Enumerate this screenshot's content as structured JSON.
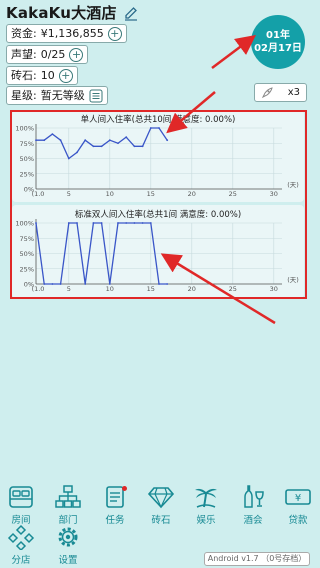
{
  "header": {
    "hotel_name": "KakaKu大酒店"
  },
  "stats": {
    "funds_label": "资金:",
    "funds_value": "¥1,136,855",
    "reputation_label": "声望:",
    "reputation_value": "0/25",
    "bricks_label": "砖石:",
    "bricks_value": "10",
    "star_label": "星级:",
    "star_value": "暂无等级"
  },
  "date": {
    "year": "01年",
    "day": "02月17日"
  },
  "speed": {
    "label": "x3"
  },
  "charts": {
    "single": {
      "title": "单人间入住率(总共10间 满意度: 0.00%)"
    },
    "double": {
      "title": "标准双人间入住率(总共1间 满意度: 0.00%)"
    }
  },
  "chart_data": [
    {
      "type": "line",
      "title": "单人间入住率(总共10间 满意度: 0.00%)",
      "xlabel": "(天)",
      "x_ticks": [
        "1.0",
        "5",
        "10",
        "15",
        "20",
        "25",
        "30"
      ],
      "y_ticks": [
        "0%",
        "25%",
        "50%",
        "75%",
        "100%"
      ],
      "xlim": [
        1,
        31
      ],
      "ylim": [
        0,
        100
      ],
      "x": [
        1,
        2,
        3,
        4,
        5,
        6,
        7,
        8,
        9,
        10,
        11,
        12,
        13,
        14,
        15,
        16,
        17
      ],
      "values": [
        80,
        80,
        90,
        80,
        50,
        60,
        80,
        70,
        70,
        80,
        75,
        85,
        70,
        70,
        100,
        100,
        80
      ],
      "color": "#3a56c8",
      "grid": true
    },
    {
      "type": "line",
      "title": "标准双人间入住率(总共1间 满意度: 0.00%)",
      "xlabel": "(天)",
      "x_ticks": [
        "1.0",
        "5",
        "10",
        "15",
        "20",
        "25",
        "30"
      ],
      "y_ticks": [
        "0%",
        "25%",
        "50%",
        "75%",
        "100%"
      ],
      "xlim": [
        1,
        31
      ],
      "ylim": [
        0,
        100
      ],
      "x": [
        1,
        2,
        3,
        4,
        5,
        6,
        7,
        8,
        9,
        10,
        11,
        12,
        13,
        14,
        15,
        16,
        17
      ],
      "values": [
        100,
        0,
        0,
        0,
        100,
        100,
        0,
        100,
        100,
        0,
        100,
        100,
        100,
        100,
        100,
        0,
        0
      ],
      "color": "#3a56c8",
      "grid": true
    }
  ],
  "nav": {
    "items": [
      {
        "label": "房间",
        "icon": "bed-icon"
      },
      {
        "label": "部门",
        "icon": "org-chart-icon"
      },
      {
        "label": "任务",
        "icon": "task-icon"
      },
      {
        "label": "砖石",
        "icon": "diamond-icon"
      },
      {
        "label": "娱乐",
        "icon": "palm-tree-icon"
      },
      {
        "label": "酒会",
        "icon": "bottle-glass-icon"
      },
      {
        "label": "贷款",
        "icon": "money-icon"
      },
      {
        "label": "分店",
        "icon": "branch-icon"
      },
      {
        "label": "设置",
        "icon": "gear-icon"
      }
    ]
  },
  "footer": {
    "version": "Android v1.7 （0号存档）"
  },
  "colors": {
    "accent": "#14a0a8",
    "background": "#cfeeee",
    "line": "#3a56c8",
    "annotation": "#e02828"
  }
}
